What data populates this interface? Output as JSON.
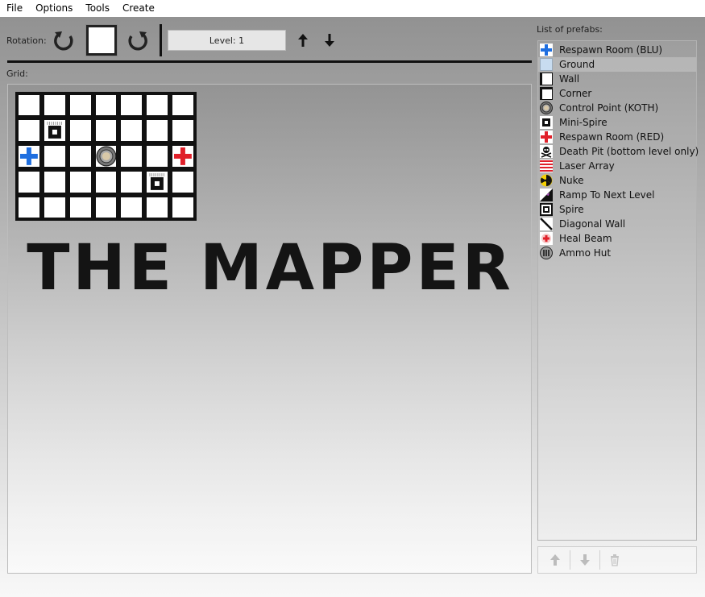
{
  "menu": [
    {
      "label": "File"
    },
    {
      "label": "Options"
    },
    {
      "label": "Tools"
    },
    {
      "label": "Create"
    }
  ],
  "toolbar": {
    "rotation_label": "Rotation:",
    "level_label": "Level: 1"
  },
  "grid": {
    "label": "Grid:",
    "title": "THE MAPPER",
    "rows": [
      [
        "ground",
        "ground",
        "ground",
        "ground",
        "ground",
        "ground",
        "ground"
      ],
      [
        "ground",
        "mini-spire",
        "ground",
        "ground",
        "ground",
        "ground",
        "ground"
      ],
      [
        "respawn-blu",
        "ground",
        "ground",
        "control-point",
        "ground",
        "ground",
        "respawn-red"
      ],
      [
        "ground",
        "ground",
        "ground",
        "ground",
        "ground",
        "mini-spire",
        "ground"
      ],
      [
        "ground",
        "ground",
        "ground",
        "ground",
        "ground",
        "ground",
        "ground"
      ]
    ]
  },
  "prefabs": {
    "label": "List of prefabs:",
    "items": [
      {
        "label": "Respawn Room (BLU)",
        "icon": "respawn-blu-icon",
        "selected": false
      },
      {
        "label": "Ground",
        "icon": "ground-icon",
        "selected": true
      },
      {
        "label": "Wall",
        "icon": "wall-icon",
        "selected": false
      },
      {
        "label": "Corner",
        "icon": "corner-icon",
        "selected": false
      },
      {
        "label": "Control Point (KOTH)",
        "icon": "control-point-icon",
        "selected": false
      },
      {
        "label": "Mini-Spire",
        "icon": "mini-spire-icon",
        "selected": false
      },
      {
        "label": "Respawn Room (RED)",
        "icon": "respawn-red-icon",
        "selected": false
      },
      {
        "label": "Death Pit (bottom level only)",
        "icon": "skull-icon",
        "selected": false
      },
      {
        "label": "Laser Array",
        "icon": "laser-array-icon",
        "selected": false
      },
      {
        "label": "Nuke",
        "icon": "radiation-icon",
        "selected": false
      },
      {
        "label": "Ramp To Next Level",
        "icon": "ramp-icon",
        "selected": false
      },
      {
        "label": "Spire",
        "icon": "spire-icon",
        "selected": false
      },
      {
        "label": "Diagonal Wall",
        "icon": "diagonal-wall-icon",
        "selected": false
      },
      {
        "label": "Heal Beam",
        "icon": "heal-beam-icon",
        "selected": false
      },
      {
        "label": "Ammo Hut",
        "icon": "ammo-hut-icon",
        "selected": false
      }
    ]
  },
  "colors": {
    "blu": "#1f6fe0",
    "red": "#e0202a",
    "ground": "#c8dcf0"
  }
}
